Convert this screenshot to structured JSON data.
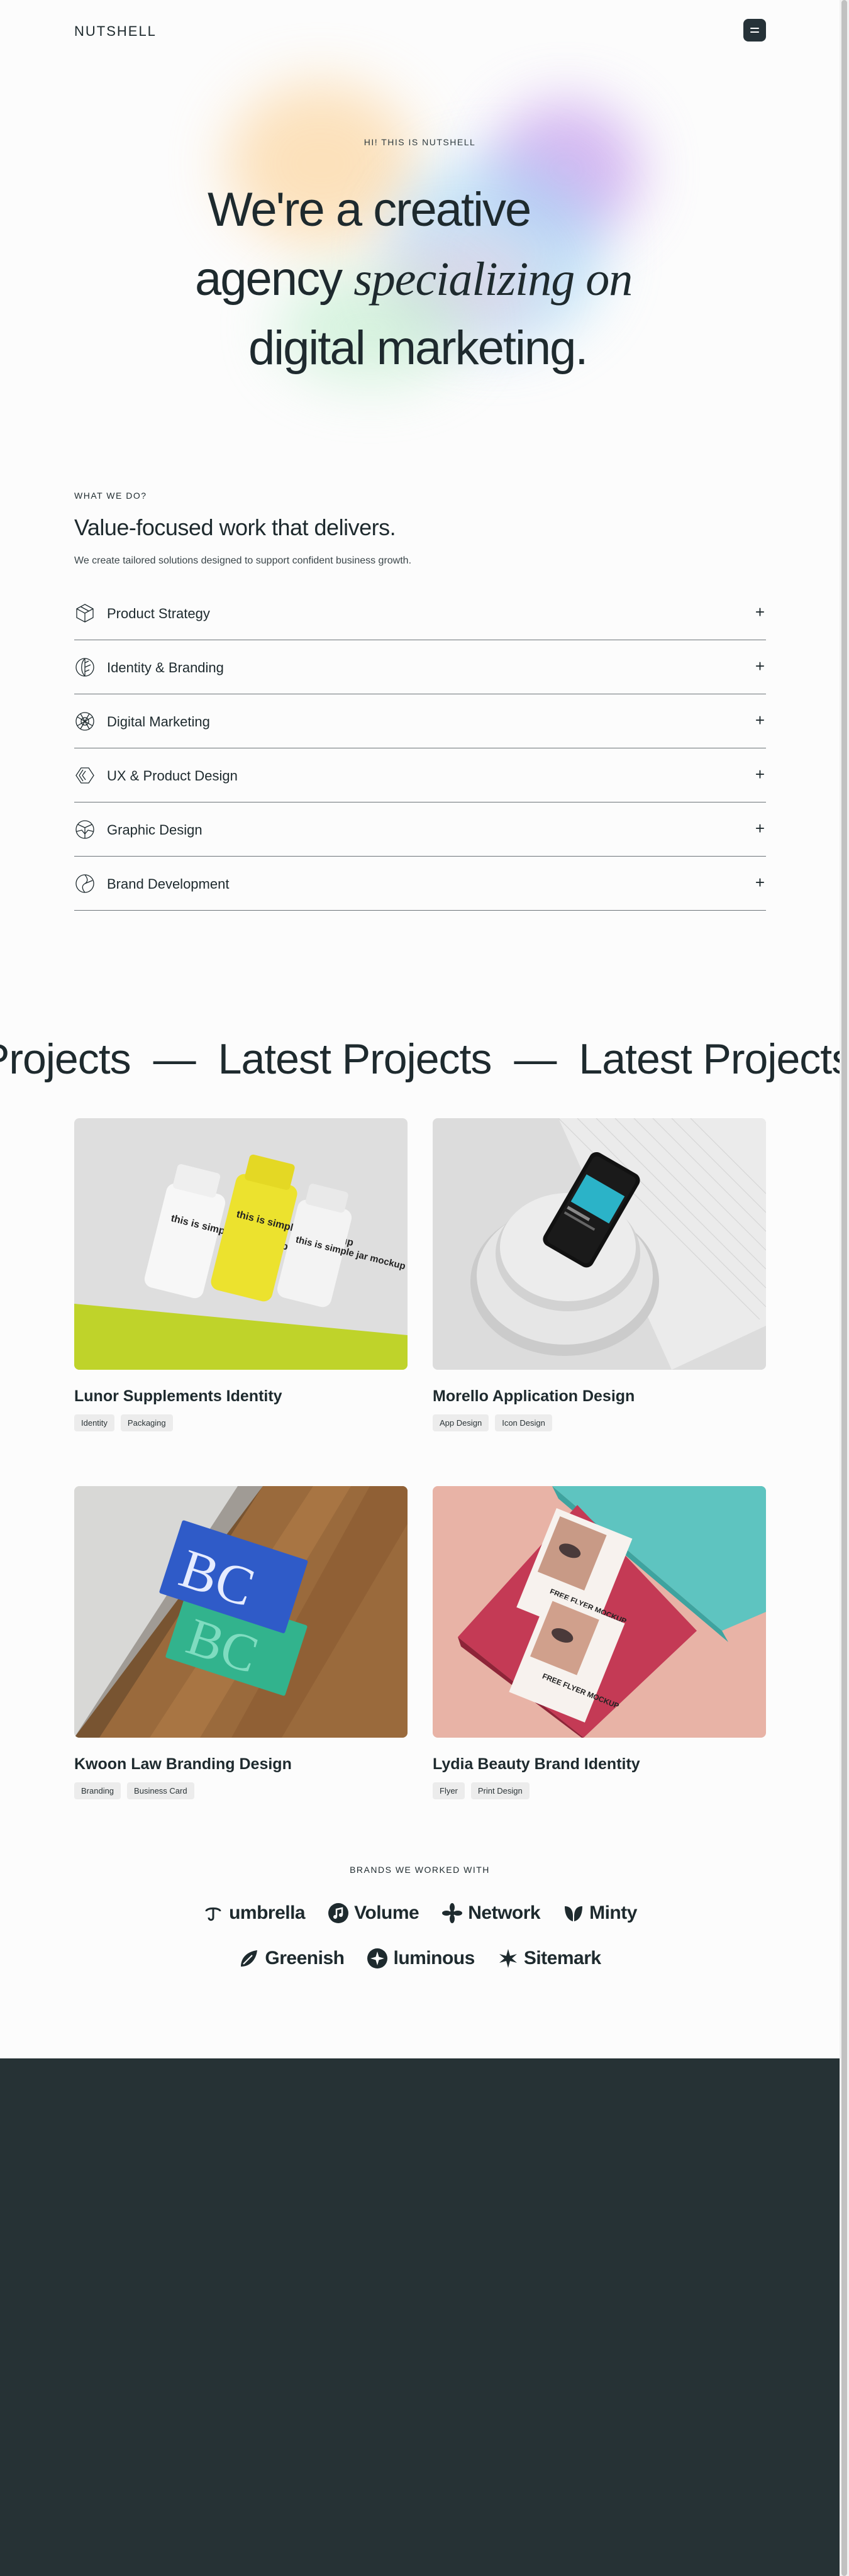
{
  "header": {
    "logo": "NUTSHELL",
    "menu_icon": "menu-icon"
  },
  "hero": {
    "eyebrow": "HI! THIS IS NUTSHELL",
    "line1": "We're a creative",
    "line2_plain": "agency ",
    "line2_italic": "specializing on",
    "line3": "digital marketing."
  },
  "services": {
    "eyebrow": "WHAT WE DO?",
    "title": "Value-focused work that delivers.",
    "description": "We create tailored solutions designed to support confident business growth.",
    "items": [
      {
        "label": "Product Strategy",
        "icon": "cube-icon"
      },
      {
        "label": "Identity & Branding",
        "icon": "leaf-icon"
      },
      {
        "label": "Digital Marketing",
        "icon": "mesh-icon"
      },
      {
        "label": "UX & Product Design",
        "icon": "prism-icon"
      },
      {
        "label": "Graphic Design",
        "icon": "globe-icon"
      },
      {
        "label": "Brand Development",
        "icon": "compass-icon"
      }
    ],
    "expand_symbol": "+"
  },
  "marquee": {
    "items": [
      "Projects",
      "Latest Projects",
      "Latest Projects"
    ],
    "separator": "—"
  },
  "projects": [
    {
      "title": "Lunor Supplements Identity",
      "tags": [
        "Identity",
        "Packaging"
      ],
      "image": "supplement-jars-mockup"
    },
    {
      "title": "Morello Application Design",
      "tags": [
        "App Design",
        "Icon Design"
      ],
      "image": "phone-on-plates-mockup"
    },
    {
      "title": "Kwoon Law Branding Design",
      "tags": [
        "Branding",
        "Business Card"
      ],
      "image": "business-cards-mockup"
    },
    {
      "title": "Lydia Beauty Brand Identity",
      "tags": [
        "Flyer",
        "Print Design"
      ],
      "image": "flyers-mockup"
    }
  ],
  "mockup_text": {
    "jar": "this is simple jar mockup",
    "card_letters": "BC",
    "flyer": "FREE FLYER MOCKUP"
  },
  "brands": {
    "eyebrow": "BRANDS WE WORKED WITH",
    "row1": [
      {
        "name": "umbrella",
        "icon": "umbrella-icon"
      },
      {
        "name": "Volume",
        "icon": "music-note-icon"
      },
      {
        "name": "Network",
        "icon": "network-icon"
      },
      {
        "name": "Minty",
        "icon": "minty-leaf-icon"
      }
    ],
    "row2": [
      {
        "name": "Greenish",
        "icon": "greenish-icon"
      },
      {
        "name": "luminous",
        "icon": "luminous-icon"
      },
      {
        "name": "Sitemark",
        "icon": "sitemark-icon"
      }
    ]
  },
  "colors": {
    "text": "#1e2a2e",
    "footer_bg": "#263235",
    "menu_button_bg": "#263238",
    "tag_bg": "#ececec"
  }
}
